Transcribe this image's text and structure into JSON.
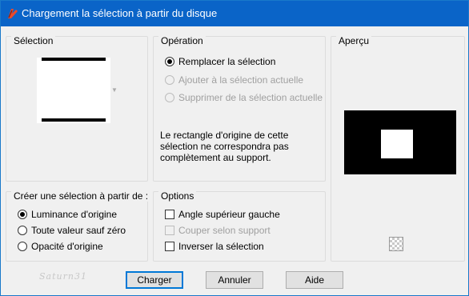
{
  "window": {
    "title": "Chargement la sélection à partir du disque"
  },
  "selection_group": {
    "title": "Sélection"
  },
  "operation_group": {
    "title": "Opération",
    "options": [
      {
        "label": "Remplacer la sélection",
        "checked": true,
        "enabled": true
      },
      {
        "label": "Ajouter à la sélection actuelle",
        "checked": false,
        "enabled": false
      },
      {
        "label": "Supprimer de la sélection actuelle",
        "checked": false,
        "enabled": false
      }
    ],
    "info": "Le rectangle d'origine de cette sélection ne correspondra pas complètement au support."
  },
  "preview_group": {
    "title": "Aperçu",
    "zoom_icon": "checkerboard-icon"
  },
  "source_group": {
    "title": "Créer une sélection à partir de :",
    "options": [
      {
        "label": "Luminance d'origine",
        "checked": true
      },
      {
        "label": "Toute valeur sauf zéro",
        "checked": false
      },
      {
        "label": "Opacité d'origine",
        "checked": false
      }
    ]
  },
  "options_group": {
    "title": "Options",
    "items": [
      {
        "label": "Angle supérieur gauche",
        "checked": false,
        "enabled": true
      },
      {
        "label": "Couper selon support",
        "checked": false,
        "enabled": false
      },
      {
        "label": "Inverser la sélection",
        "checked": false,
        "enabled": true
      }
    ]
  },
  "buttons": {
    "load": "Charger",
    "cancel": "Annuler",
    "help": "Aide"
  },
  "watermark": "Saturn31"
}
